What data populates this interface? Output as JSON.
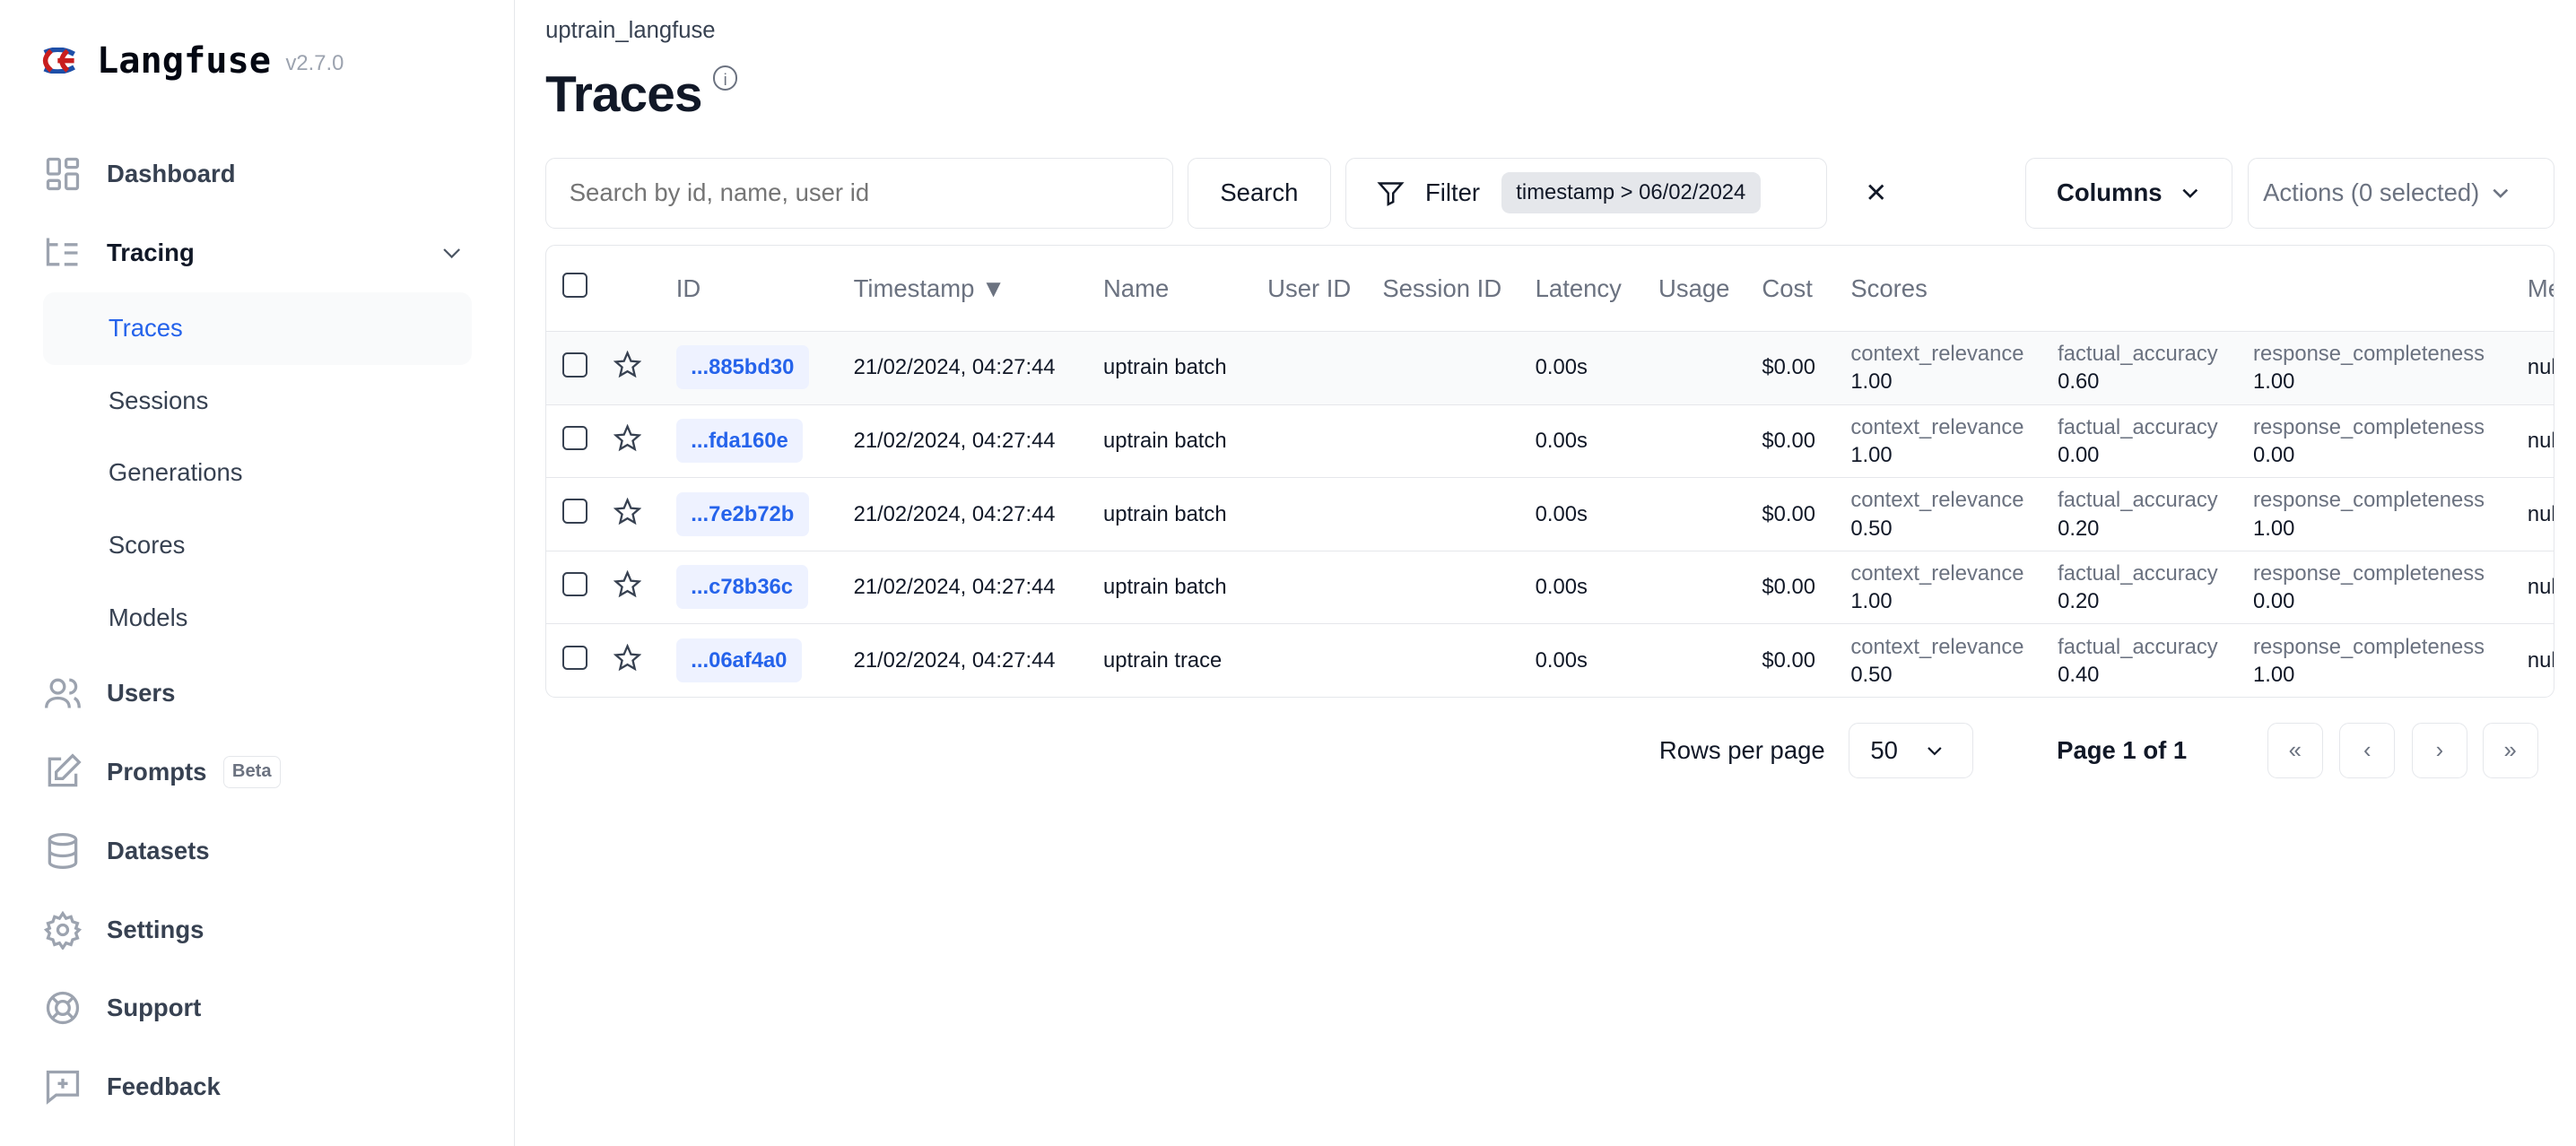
{
  "app": {
    "name": "Langfuse",
    "version": "v2.7.0"
  },
  "sidebar": {
    "items": [
      {
        "label": "Dashboard",
        "icon": "dashboard-icon"
      },
      {
        "label": "Tracing",
        "icon": "tracing-icon"
      },
      {
        "label": "Traces"
      },
      {
        "label": "Sessions"
      },
      {
        "label": "Generations"
      },
      {
        "label": "Scores"
      },
      {
        "label": "Models"
      },
      {
        "label": "Users",
        "icon": "users-icon"
      },
      {
        "label": "Prompts",
        "icon": "prompts-icon",
        "badge": "Beta"
      },
      {
        "label": "Datasets",
        "icon": "database-icon"
      },
      {
        "label": "Settings",
        "icon": "gear-icon"
      },
      {
        "label": "Support",
        "icon": "lifebuoy-icon"
      },
      {
        "label": "Feedback",
        "icon": "feedback-icon"
      }
    ]
  },
  "header": {
    "breadcrumb": "uptrain_langfuse",
    "title": "Traces",
    "info": "i"
  },
  "toolbar": {
    "search_placeholder": "Search by id, name, user id",
    "search_label": "Search",
    "filter_label": "Filter",
    "filter_chip": "timestamp > 06/02/2024",
    "clear": "✕",
    "columns_label": "Columns",
    "actions_label": "Actions (0 selected)"
  },
  "table": {
    "headers": [
      "ID",
      "Timestamp ▼",
      "Name",
      "User ID",
      "Session ID",
      "Latency",
      "Usage",
      "Cost",
      "Scores",
      "Metadata"
    ],
    "rows": [
      {
        "id": "...885bd30",
        "timestamp": "21/02/2024, 04:27:44",
        "name": "uptrain batch",
        "latency": "0.00s",
        "cost": "$0.00",
        "scores": [
          {
            "k": "context_relevance",
            "v": "1.00"
          },
          {
            "k": "factual_accuracy",
            "v": "0.60"
          },
          {
            "k": "response_completeness",
            "v": "1.00"
          }
        ],
        "metadata": "null"
      },
      {
        "id": "...fda160e",
        "timestamp": "21/02/2024, 04:27:44",
        "name": "uptrain batch",
        "latency": "0.00s",
        "cost": "$0.00",
        "scores": [
          {
            "k": "context_relevance",
            "v": "1.00"
          },
          {
            "k": "factual_accuracy",
            "v": "0.00"
          },
          {
            "k": "response_completeness",
            "v": "0.00"
          }
        ],
        "metadata": "null"
      },
      {
        "id": "...7e2b72b",
        "timestamp": "21/02/2024, 04:27:44",
        "name": "uptrain batch",
        "latency": "0.00s",
        "cost": "$0.00",
        "scores": [
          {
            "k": "context_relevance",
            "v": "0.50"
          },
          {
            "k": "factual_accuracy",
            "v": "0.20"
          },
          {
            "k": "response_completeness",
            "v": "1.00"
          }
        ],
        "metadata": "null"
      },
      {
        "id": "...c78b36c",
        "timestamp": "21/02/2024, 04:27:44",
        "name": "uptrain batch",
        "latency": "0.00s",
        "cost": "$0.00",
        "scores": [
          {
            "k": "context_relevance",
            "v": "1.00"
          },
          {
            "k": "factual_accuracy",
            "v": "0.20"
          },
          {
            "k": "response_completeness",
            "v": "0.00"
          }
        ],
        "metadata": "null"
      },
      {
        "id": "...06af4a0",
        "timestamp": "21/02/2024, 04:27:44",
        "name": "uptrain trace",
        "latency": "0.00s",
        "cost": "$0.00",
        "scores": [
          {
            "k": "context_relevance",
            "v": "0.50"
          },
          {
            "k": "factual_accuracy",
            "v": "0.40"
          },
          {
            "k": "response_completeness",
            "v": "1.00"
          }
        ],
        "metadata": "null"
      }
    ]
  },
  "pagination": {
    "rows_per_page_label": "Rows per page",
    "rows_per_page": "50",
    "page_label": "Page 1 of 1",
    "first": "«",
    "prev": "‹",
    "next": "›",
    "last": "»"
  },
  "colors": {
    "accent": "#2563eb",
    "border": "#e5e7eb"
  }
}
